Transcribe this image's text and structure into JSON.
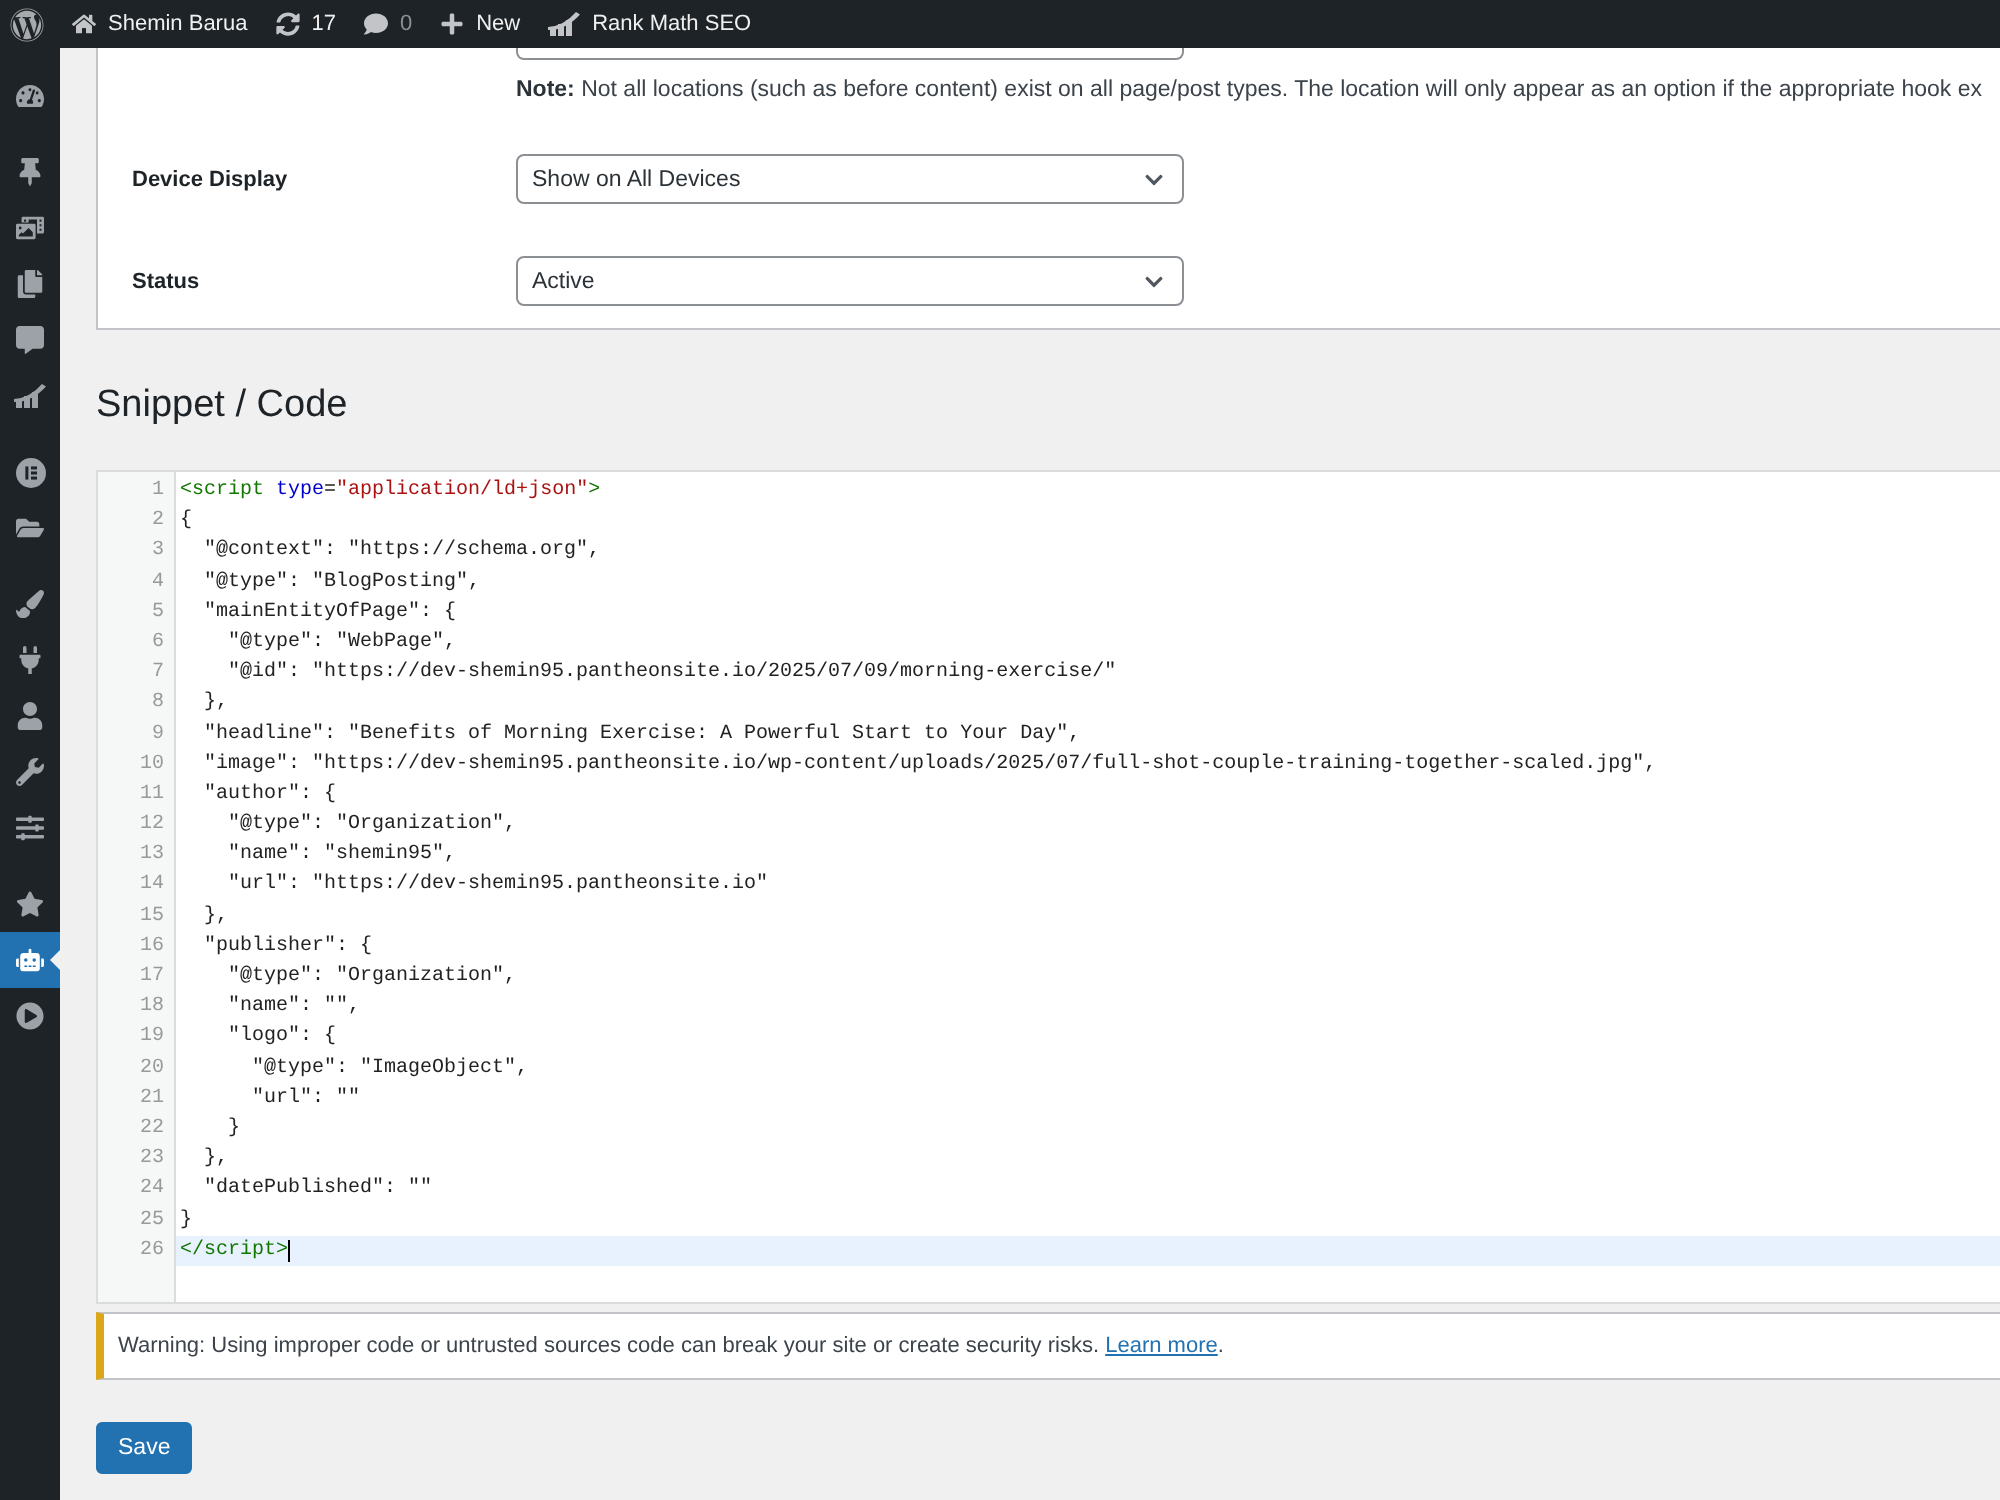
{
  "admin_bar": {
    "items": [
      {
        "label": "Shemin Barua",
        "dimmed": false
      },
      {
        "label": "17",
        "dimmed": false
      },
      {
        "label": "0",
        "dimmed": true
      },
      {
        "label": "New",
        "dimmed": false
      },
      {
        "label": "Rank Math SEO",
        "dimmed": false
      }
    ]
  },
  "sidebar": {
    "groups": [
      {
        "items": [
          {
            "selected": false
          }
        ]
      },
      {
        "items": [
          {
            "selected": false
          },
          {
            "selected": false
          },
          {
            "selected": false
          },
          {
            "selected": false
          },
          {
            "selected": false
          }
        ]
      },
      {
        "items": [
          {
            "selected": false
          },
          {
            "selected": false
          }
        ]
      },
      {
        "items": [
          {
            "selected": false
          },
          {
            "selected": false
          },
          {
            "selected": false
          },
          {
            "selected": false
          },
          {
            "selected": false
          }
        ]
      },
      {
        "items": [
          {
            "selected": false
          },
          {
            "selected": true
          },
          {
            "selected": false
          }
        ]
      }
    ]
  },
  "settings": {
    "note": "**Note:** Not all locations (such as before content) exist on all page/post types. The location will only appear as an option if the appropriate hook ex",
    "fields": [
      {
        "label": "Device Display",
        "value": "Show on All Devices"
      },
      {
        "label": "Status",
        "value": "Active"
      }
    ]
  },
  "snippet": {
    "title": "Snippet / Code",
    "lines": [
      {
        "number": "1",
        "active": false,
        "tokens": [
          {
            "kind": "tag",
            "text": "<script"
          },
          {
            "kind": "attribute",
            "text": " type"
          },
          {
            "kind": "plain",
            "text": "="
          },
          {
            "kind": "string",
            "text": "\"application/ld+json\""
          },
          {
            "kind": "tag",
            "text": ">"
          }
        ]
      },
      {
        "number": "2",
        "active": false,
        "tokens": [
          {
            "kind": "plain",
            "text": "{"
          }
        ]
      },
      {
        "number": "3",
        "active": false,
        "tokens": [
          {
            "kind": "plain",
            "text": "  \"@context\": \"https://schema.org\","
          }
        ]
      },
      {
        "number": "4",
        "active": false,
        "tokens": [
          {
            "kind": "plain",
            "text": "  \"@type\": \"BlogPosting\","
          }
        ]
      },
      {
        "number": "5",
        "active": false,
        "tokens": [
          {
            "kind": "plain",
            "text": "  \"mainEntityOfPage\": {"
          }
        ]
      },
      {
        "number": "6",
        "active": false,
        "tokens": [
          {
            "kind": "plain",
            "text": "    \"@type\": \"WebPage\","
          }
        ]
      },
      {
        "number": "7",
        "active": false,
        "tokens": [
          {
            "kind": "plain",
            "text": "    \"@id\": \"https://dev-shemin95.pantheonsite.io/2025/07/09/morning-exercise/\""
          }
        ]
      },
      {
        "number": "8",
        "active": false,
        "tokens": [
          {
            "kind": "plain",
            "text": "  },"
          }
        ]
      },
      {
        "number": "9",
        "active": false,
        "tokens": [
          {
            "kind": "plain",
            "text": "  \"headline\": \"Benefits of Morning Exercise: A Powerful Start to Your Day\","
          }
        ]
      },
      {
        "number": "10",
        "active": false,
        "tokens": [
          {
            "kind": "plain",
            "text": "  \"image\": \"https://dev-shemin95.pantheonsite.io/wp-content/uploads/2025/07/full-shot-couple-training-together-scaled.jpg\","
          }
        ]
      },
      {
        "number": "11",
        "active": false,
        "tokens": [
          {
            "kind": "plain",
            "text": "  \"author\": {"
          }
        ]
      },
      {
        "number": "12",
        "active": false,
        "tokens": [
          {
            "kind": "plain",
            "text": "    \"@type\": \"Organization\","
          }
        ]
      },
      {
        "number": "13",
        "active": false,
        "tokens": [
          {
            "kind": "plain",
            "text": "    \"name\": \"shemin95\","
          }
        ]
      },
      {
        "number": "14",
        "active": false,
        "tokens": [
          {
            "kind": "plain",
            "text": "    \"url\": \"https://dev-shemin95.pantheonsite.io\""
          }
        ]
      },
      {
        "number": "15",
        "active": false,
        "tokens": [
          {
            "kind": "plain",
            "text": "  },"
          }
        ]
      },
      {
        "number": "16",
        "active": false,
        "tokens": [
          {
            "kind": "plain",
            "text": "  \"publisher\": {"
          }
        ]
      },
      {
        "number": "17",
        "active": false,
        "tokens": [
          {
            "kind": "plain",
            "text": "    \"@type\": \"Organization\","
          }
        ]
      },
      {
        "number": "18",
        "active": false,
        "tokens": [
          {
            "kind": "plain",
            "text": "    \"name\": \"\","
          }
        ]
      },
      {
        "number": "19",
        "active": false,
        "tokens": [
          {
            "kind": "plain",
            "text": "    \"logo\": {"
          }
        ]
      },
      {
        "number": "20",
        "active": false,
        "tokens": [
          {
            "kind": "plain",
            "text": "      \"@type\": \"ImageObject\","
          }
        ]
      },
      {
        "number": "21",
        "active": false,
        "tokens": [
          {
            "kind": "plain",
            "text": "      \"url\": \"\""
          }
        ]
      },
      {
        "number": "22",
        "active": false,
        "tokens": [
          {
            "kind": "plain",
            "text": "    }"
          }
        ]
      },
      {
        "number": "23",
        "active": false,
        "tokens": [
          {
            "kind": "plain",
            "text": "  },"
          }
        ]
      },
      {
        "number": "24",
        "active": false,
        "tokens": [
          {
            "kind": "plain",
            "text": "  \"datePublished\": \"\""
          }
        ]
      },
      {
        "number": "25",
        "active": false,
        "tokens": [
          {
            "kind": "plain",
            "text": "}"
          }
        ]
      },
      {
        "number": "26",
        "active": true,
        "tokens": [
          {
            "kind": "tag",
            "text": "</script>"
          }
        ]
      }
    ]
  },
  "notice": {
    "text": "Warning: Using improper code or untrusted sources code can break your site or create security risks.",
    "link": "Learn more",
    "suffix": "."
  },
  "save_button": {
    "label": "Save"
  }
}
